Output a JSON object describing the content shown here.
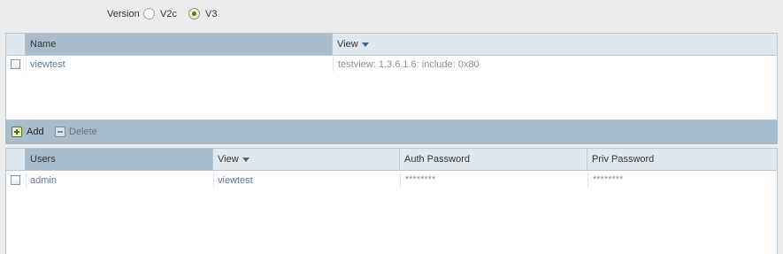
{
  "version": {
    "label": "Version",
    "options": [
      {
        "label": "V2c",
        "selected": false
      },
      {
        "label": "V3",
        "selected": true
      }
    ]
  },
  "views_table": {
    "columns": [
      "Name",
      "View"
    ],
    "sorted_column": "View",
    "rows": [
      {
        "name": "viewtest",
        "view": "testview: 1.3.6.1.6: include: 0x80"
      }
    ]
  },
  "toolbar": {
    "add_label": "Add",
    "delete_label": "Delete"
  },
  "users_table": {
    "columns": [
      "Users",
      "View",
      "Auth Password",
      "Priv Password"
    ],
    "sorted_column": "View",
    "rows": [
      {
        "user": "admin",
        "view": "viewtest",
        "auth_password": "********",
        "priv_password": "********"
      }
    ]
  },
  "colors": {
    "header_bg": "#dfe8ef",
    "sorted_header_bg": "#a9bccb",
    "toolbar_bg": "#a9bccb",
    "accent_green": "#5b7a1e"
  }
}
